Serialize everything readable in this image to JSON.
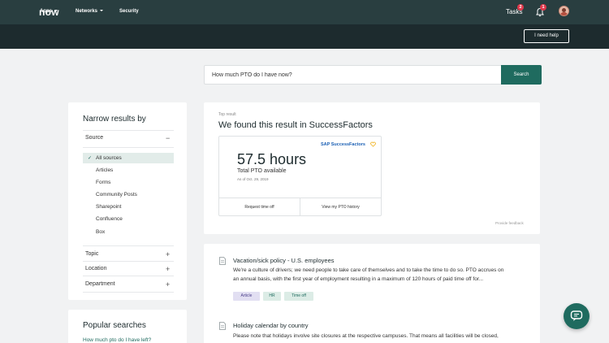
{
  "header": {
    "logo": "now",
    "tasks_label": "Tasks",
    "tasks_count": "2",
    "notifications_count": "1"
  },
  "nav": {
    "items": [
      "Apps",
      "Networks",
      "Security"
    ],
    "help_label": "I need help"
  },
  "search": {
    "query": "How much PTO do I have now?",
    "button_label": "Search"
  },
  "filters": {
    "title": "Narrow results by",
    "source_label": "Source",
    "sources": [
      "All sources",
      "Articles",
      "Forms",
      "Community Posts",
      "Sharepoint",
      "Confluence",
      "Box"
    ],
    "selected_source": "All sources",
    "topic_label": "Topic",
    "location_label": "Location",
    "department_label": "Department"
  },
  "popular": {
    "title": "Popular searches",
    "link": "How much pto do I have left?"
  },
  "top_result": {
    "label": "Top result",
    "title": "We found this result in SuccessFactors",
    "brand": "SAP SuccessFactors",
    "hours": "57.5 hours",
    "subtitle": "Total PTO available",
    "as_of": "As of Oct. 29, 2019",
    "action_1": "Request time off",
    "action_2": "View my PTO history",
    "feedback": "Provide feedback"
  },
  "results": [
    {
      "title": "Vacation/sick policy - U.S. employees",
      "snippet_1": "We're a culture of drivers; we need people to take care of themselves and to take the time to do so. PTO accrues on",
      "snippet_2": "an annual basis, with the first year of employment resulting in a maximum of 120 hours of paid time off for...",
      "tags": [
        "Article",
        "HR",
        "Time off"
      ]
    },
    {
      "title": "Holiday calendar by country",
      "snippet_1": "Please note that holidays involve site closures at the respective campuses. That means all facilities will be closed,"
    }
  ],
  "colors": {
    "header_bg": "#293e40",
    "nav_bg": "#1d2b2e",
    "accent": "#1f6b5f",
    "badge": "#e0384b"
  }
}
